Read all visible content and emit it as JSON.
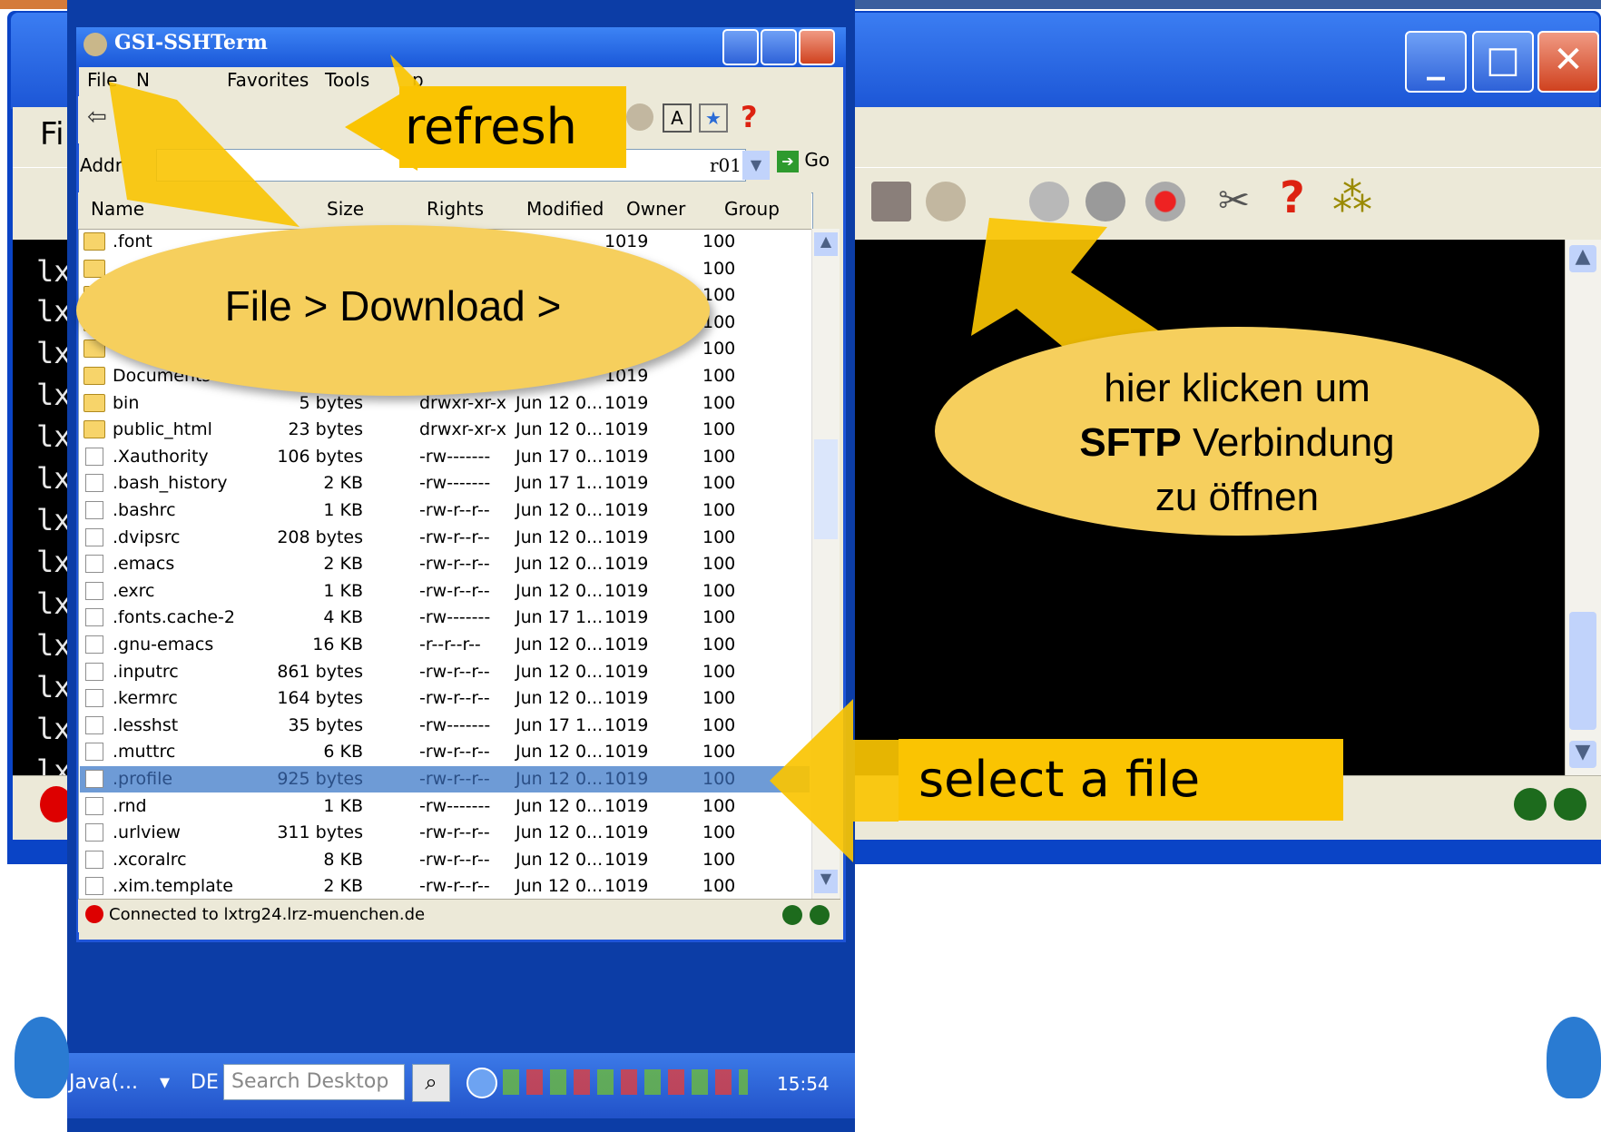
{
  "sftp": {
    "title": "GSI-SSHTerm",
    "menu": [
      "File",
      "N",
      "Favorites",
      "Tools",
      "p"
    ],
    "address_label": "Addr",
    "address_value": "r01",
    "go_label": "Go",
    "columns": [
      "Name",
      "Size",
      "Rights",
      "Modified",
      "Owner",
      "Group"
    ],
    "files": [
      {
        "name": ".font",
        "size": "",
        "rights": "",
        "modified": "",
        "owner": "1019",
        "group": "100",
        "type": "folder"
      },
      {
        "name": "",
        "size": "",
        "rights": "",
        "modified": "",
        "owner": "",
        "group": "100",
        "type": "folder"
      },
      {
        "name": "",
        "size": "",
        "rights": "",
        "modified": "",
        "owner": "",
        "group": "100",
        "type": "folder"
      },
      {
        "name": "",
        "size": "",
        "rights": "",
        "modified": "",
        "owner": "",
        "group": "100",
        "type": "folder"
      },
      {
        "name": "",
        "size": "",
        "rights": "",
        "modified": "",
        "owner": "",
        "group": "100",
        "type": "folder"
      },
      {
        "name": "Documents",
        "size": "",
        "rights": "",
        "modified": "",
        "owner": "1019",
        "group": "100",
        "type": "folder"
      },
      {
        "name": "bin",
        "size": "5 bytes",
        "rights": "drwxr-xr-x",
        "modified": "Jun 12 0...",
        "owner": "1019",
        "group": "100",
        "type": "folder"
      },
      {
        "name": "public_html",
        "size": "23 bytes",
        "rights": "drwxr-xr-x",
        "modified": "Jun 12 0...",
        "owner": "1019",
        "group": "100",
        "type": "folder"
      },
      {
        "name": ".Xauthority",
        "size": "106 bytes",
        "rights": "-rw-------",
        "modified": "Jun 17 0...",
        "owner": "1019",
        "group": "100",
        "type": "file"
      },
      {
        "name": ".bash_history",
        "size": "2 KB",
        "rights": "-rw-------",
        "modified": "Jun 17 1...",
        "owner": "1019",
        "group": "100",
        "type": "file"
      },
      {
        "name": ".bashrc",
        "size": "1 KB",
        "rights": "-rw-r--r--",
        "modified": "Jun 12 0...",
        "owner": "1019",
        "group": "100",
        "type": "file"
      },
      {
        "name": ".dvipsrc",
        "size": "208 bytes",
        "rights": "-rw-r--r--",
        "modified": "Jun 12 0...",
        "owner": "1019",
        "group": "100",
        "type": "file"
      },
      {
        "name": ".emacs",
        "size": "2 KB",
        "rights": "-rw-r--r--",
        "modified": "Jun 12 0...",
        "owner": "1019",
        "group": "100",
        "type": "file"
      },
      {
        "name": ".exrc",
        "size": "1 KB",
        "rights": "-rw-r--r--",
        "modified": "Jun 12 0...",
        "owner": "1019",
        "group": "100",
        "type": "file"
      },
      {
        "name": ".fonts.cache-2",
        "size": "4 KB",
        "rights": "-rw-------",
        "modified": "Jun 17 1...",
        "owner": "1019",
        "group": "100",
        "type": "file"
      },
      {
        "name": ".gnu-emacs",
        "size": "16 KB",
        "rights": "-r--r--r--",
        "modified": "Jun 12 0...",
        "owner": "1019",
        "group": "100",
        "type": "file"
      },
      {
        "name": ".inputrc",
        "size": "861 bytes",
        "rights": "-rw-r--r--",
        "modified": "Jun 12 0...",
        "owner": "1019",
        "group": "100",
        "type": "file"
      },
      {
        "name": ".kermrc",
        "size": "164 bytes",
        "rights": "-rw-r--r--",
        "modified": "Jun 12 0...",
        "owner": "1019",
        "group": "100",
        "type": "file"
      },
      {
        "name": ".lesshst",
        "size": "35 bytes",
        "rights": "-rw-------",
        "modified": "Jun 17 1...",
        "owner": "1019",
        "group": "100",
        "type": "file"
      },
      {
        "name": ".muttrc",
        "size": "6 KB",
        "rights": "-rw-r--r--",
        "modified": "Jun 12 0...",
        "owner": "1019",
        "group": "100",
        "type": "file"
      },
      {
        "name": ".profile",
        "size": "925 bytes",
        "rights": "-rw-r--r--",
        "modified": "Jun 12 0...",
        "owner": "1019",
        "group": "100",
        "type": "file",
        "selected": true
      },
      {
        "name": ".rnd",
        "size": "1 KB",
        "rights": "-rw-------",
        "modified": "Jun 12 0...",
        "owner": "1019",
        "group": "100",
        "type": "file"
      },
      {
        "name": ".urlview",
        "size": "311 bytes",
        "rights": "-rw-r--r--",
        "modified": "Jun 12 0...",
        "owner": "1019",
        "group": "100",
        "type": "file"
      },
      {
        "name": ".xcoralrc",
        "size": "8 KB",
        "rights": "-rw-r--r--",
        "modified": "Jun 12 0...",
        "owner": "1019",
        "group": "100",
        "type": "file"
      },
      {
        "name": ".xim.template",
        "size": "2 KB",
        "rights": "-rw-r--r--",
        "modified": "Jun 12 0...",
        "owner": "1019",
        "group": "100",
        "type": "file"
      }
    ],
    "status": "Connected to lxtrg24.lrz-muenchen.de"
  },
  "terminal": {
    "menu_fragment": "Fi",
    "line_prefix": "lx"
  },
  "taskbar": {
    "app": "Java(...",
    "lang": "DE",
    "search_placeholder": "Search Desktop",
    "clock": "15:54"
  },
  "annotations": {
    "refresh": "refresh",
    "download": "File > Download >",
    "sftp_line1": "hier klicken um",
    "sftp_bold": "SFTP",
    "sftp_line2_rest": " Verbindung",
    "sftp_line3": "zu öffnen",
    "select": "select a file"
  },
  "colors": {
    "callout": "#fac402",
    "ellipse": "#f6cf5d",
    "xp_blue": "#0a44c6"
  }
}
